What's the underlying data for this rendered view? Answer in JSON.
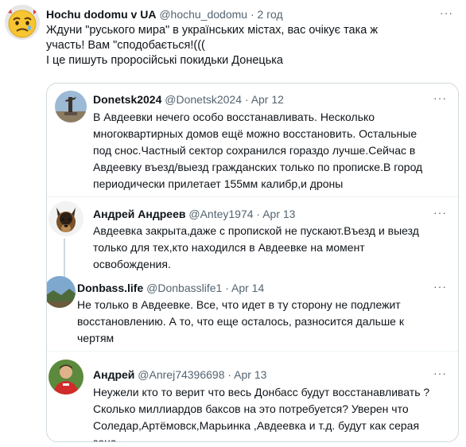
{
  "main_tweet": {
    "name": "Hochu dodomu v UA",
    "handle": "@hochu_dodomu",
    "separator": "·",
    "time": "2 год",
    "more_icon": "···",
    "text_lines": [
      "Ждуни \"руського мира\" в українських містах, вас очікує така ж",
      "участь! Вам \"сподобається!(((",
      "І це пишуть проросійські покидьки Донецька"
    ]
  },
  "quoted_replies": [
    {
      "name": "Donetsk2024",
      "handle": "@Donetsk2024",
      "separator": "·",
      "time": "Apr 12",
      "more_icon": "···",
      "text_lines": [
        "В Авдеевки нечего особо восстанавливать. Несколько",
        "многоквартирных домов ещё можно восстановить. Остальные",
        "под снос.Частный сектор сохранился гораздо лучше.Сейчас в",
        "Авдеевку въезд/выезд гражданских только по прописке.В город",
        "периодически прилетает 155мм калибр,и дроны"
      ]
    },
    {
      "name": "Андрей Андреев",
      "handle": "@Antey1974",
      "separator": "·",
      "time": "Apr 13",
      "more_icon": "···",
      "text_lines": [
        "Авдеевка закрыта,даже с пропиской не пускают.Въезд и выезд",
        "только для тех,кто находился в Авдеевке на момент",
        "освобождения."
      ]
    },
    {
      "name": "Donbass.life",
      "handle": "@Donbasslife1",
      "separator": "·",
      "time": "Apr 14",
      "more_icon": "···",
      "text_lines": [
        "Не только в Авдеевке. Все, что идет в ту сторону не подлежит",
        "восстановлению. А то, что еще осталось, разносится дальше к",
        "чертям"
      ]
    },
    {
      "name": "Андрей",
      "handle": "@Anrej74396698",
      "separator": "·",
      "time": "Apr 13",
      "more_icon": "···",
      "text_lines": [
        "Неужели кто то верит что весь Донбасс будут восстанавливать ?",
        "Сколько миллиардов баксов на это потребуется? Уверен что",
        "Соледар,Артёмовск,Марьинка ,Авдеевка и т.д. будут как серая",
        "зона"
      ]
    }
  ]
}
